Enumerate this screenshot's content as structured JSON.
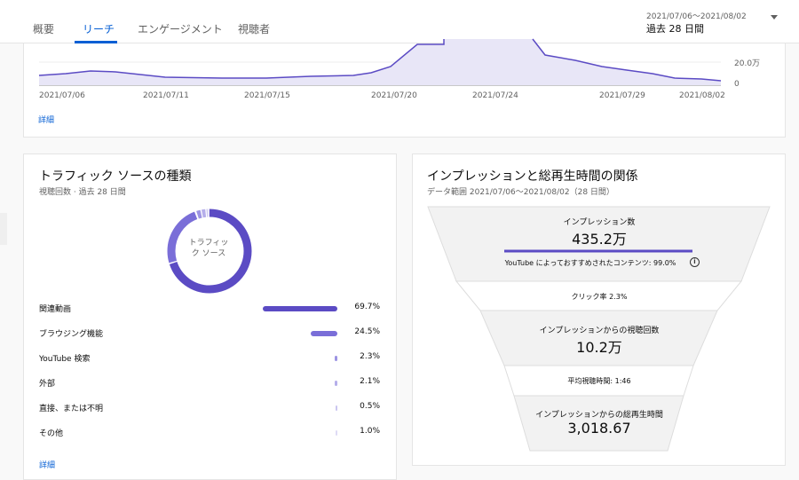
{
  "tabs": [
    {
      "label": "概要"
    },
    {
      "label": "リーチ"
    },
    {
      "label": "エンゲージメント"
    },
    {
      "label": "視聴者"
    }
  ],
  "date_range": {
    "dates": "2021/07/06～2021/08/02",
    "label": "過去 28 日間"
  },
  "top_chart": {
    "x_labels": [
      "2021/07/06",
      "2021/07/11",
      "2021/07/15",
      "2021/07/20",
      "2021/07/24",
      "2021/07/29",
      "2021/08/02"
    ],
    "y_labels": [
      "20.0万",
      "0"
    ],
    "details_link": "詳細"
  },
  "traffic": {
    "title": "トラフィック ソースの種類",
    "subtitle": "視聴回数 · 過去 28 日間",
    "donut_center": [
      "トラフィッ",
      "ク ソース"
    ],
    "sources": [
      {
        "label": "関連動画",
        "value": "69.7%",
        "share": 0.697,
        "color": "#5b4bc4"
      },
      {
        "label": "ブラウジング機能",
        "value": "24.5%",
        "share": 0.245,
        "color": "#7a6ed8"
      },
      {
        "label": "YouTube 検索",
        "value": "2.3%",
        "share": 0.023,
        "color": "#9d94e3"
      },
      {
        "label": "外部",
        "value": "2.1%",
        "share": 0.021,
        "color": "#b5aeea"
      },
      {
        "label": "直接、または不明",
        "value": "0.5%",
        "share": 0.005,
        "color": "#cbc6f0"
      },
      {
        "label": "その他",
        "value": "1.0%",
        "share": 0.01,
        "color": "#dedbf5"
      }
    ],
    "details_link": "詳細"
  },
  "funnel": {
    "title": "インプレッションと総再生時間の関係",
    "subtitle": "データ範囲 2021/07/06～2021/08/02（28 日間）",
    "impressions_label": "インプレッション数",
    "impressions_value": "435.2万",
    "recommended_text": "YouTube によっておすすめされたコンテンツ: 99.0%",
    "ctr_text": "クリック率 2.3%",
    "views_label": "インプレッションからの視聴回数",
    "views_value": "10.2万",
    "avg_duration_text": "平均視聴時間: 1:46",
    "watch_time_label": "インプレッションからの総再生時間",
    "watch_time_value": "3,018.67"
  }
}
